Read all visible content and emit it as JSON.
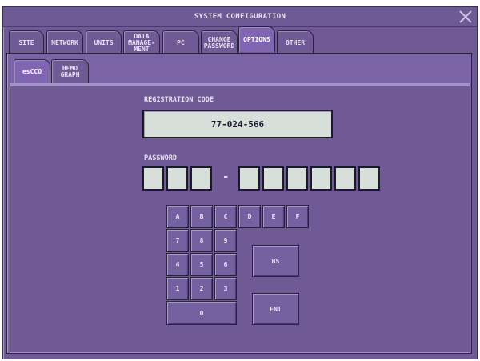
{
  "window": {
    "title": "SYSTEM CONFIGURATION"
  },
  "tabs": [
    {
      "label": "SITE"
    },
    {
      "label": "NETWORK"
    },
    {
      "label": "UNITS"
    },
    {
      "label": "DATA\nMANAGE-\nMENT"
    },
    {
      "label": "PC"
    },
    {
      "label": "CHANGE\nPASSWORD"
    },
    {
      "label": "OPTIONS",
      "active": true
    },
    {
      "label": "OTHER"
    }
  ],
  "subtabs": [
    {
      "label": "esCCO",
      "active": true
    },
    {
      "label": "HEMO\nGRAPH"
    }
  ],
  "registration": {
    "label": "REGISTRATION CODE",
    "value": "77-024-566"
  },
  "password": {
    "label": "PASSWORD",
    "separator": "-"
  },
  "keypad": {
    "hex_row": [
      "A",
      "B",
      "C",
      "D",
      "E",
      "F"
    ],
    "row1": [
      "7",
      "8",
      "9"
    ],
    "row2": [
      "4",
      "5",
      "6"
    ],
    "row3": [
      "1",
      "2",
      "3"
    ],
    "zero": "0",
    "bs": "BS",
    "ent": "ENT"
  },
  "colors": {
    "background": "#6f5a95",
    "field": "#d6dfd9",
    "active_tab": "#8066b2"
  }
}
